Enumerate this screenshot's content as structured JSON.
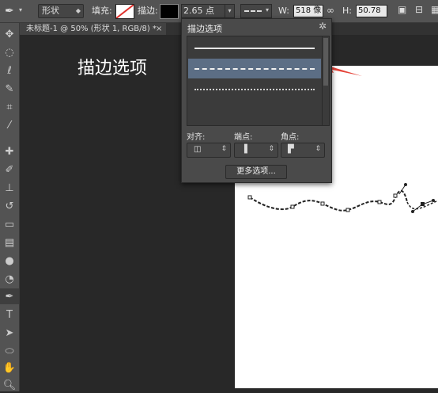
{
  "options_bar": {
    "mode_value": "形状",
    "fill_label": "填充:",
    "stroke_label": "描边:",
    "stroke_width": "2.65 点",
    "w_label": "W:",
    "w_value": "518 像",
    "h_label": "H:",
    "h_value": "50.78"
  },
  "tab": {
    "title": "未标题-1 @ 50% (形状 1, RGB/8) *",
    "close": "×"
  },
  "canvas_text": "描边选项",
  "popup": {
    "title": "描边选项",
    "stroke_styles": [
      "solid",
      "dashed",
      "dotted"
    ],
    "selected_index": 1,
    "align_label": "对齐:",
    "caps_label": "端点:",
    "corners_label": "角点:",
    "more_button": "更多选项..."
  },
  "colors": {
    "accent_arrow": "#e5443a",
    "selection": "#5c6e85",
    "panel": "#4a4a4a"
  },
  "tools": [
    "move-icon",
    "marquee-icon",
    "lasso-icon",
    "quick-select-icon",
    "crop-icon",
    "eyedropper-icon",
    "healing-icon",
    "brush-icon",
    "stamp-icon",
    "history-brush-icon",
    "eraser-icon",
    "gradient-icon",
    "blur-icon",
    "dodge-icon",
    "pen-icon",
    "type-icon",
    "path-select-icon",
    "shape-icon",
    "hand-icon",
    "zoom-icon"
  ]
}
